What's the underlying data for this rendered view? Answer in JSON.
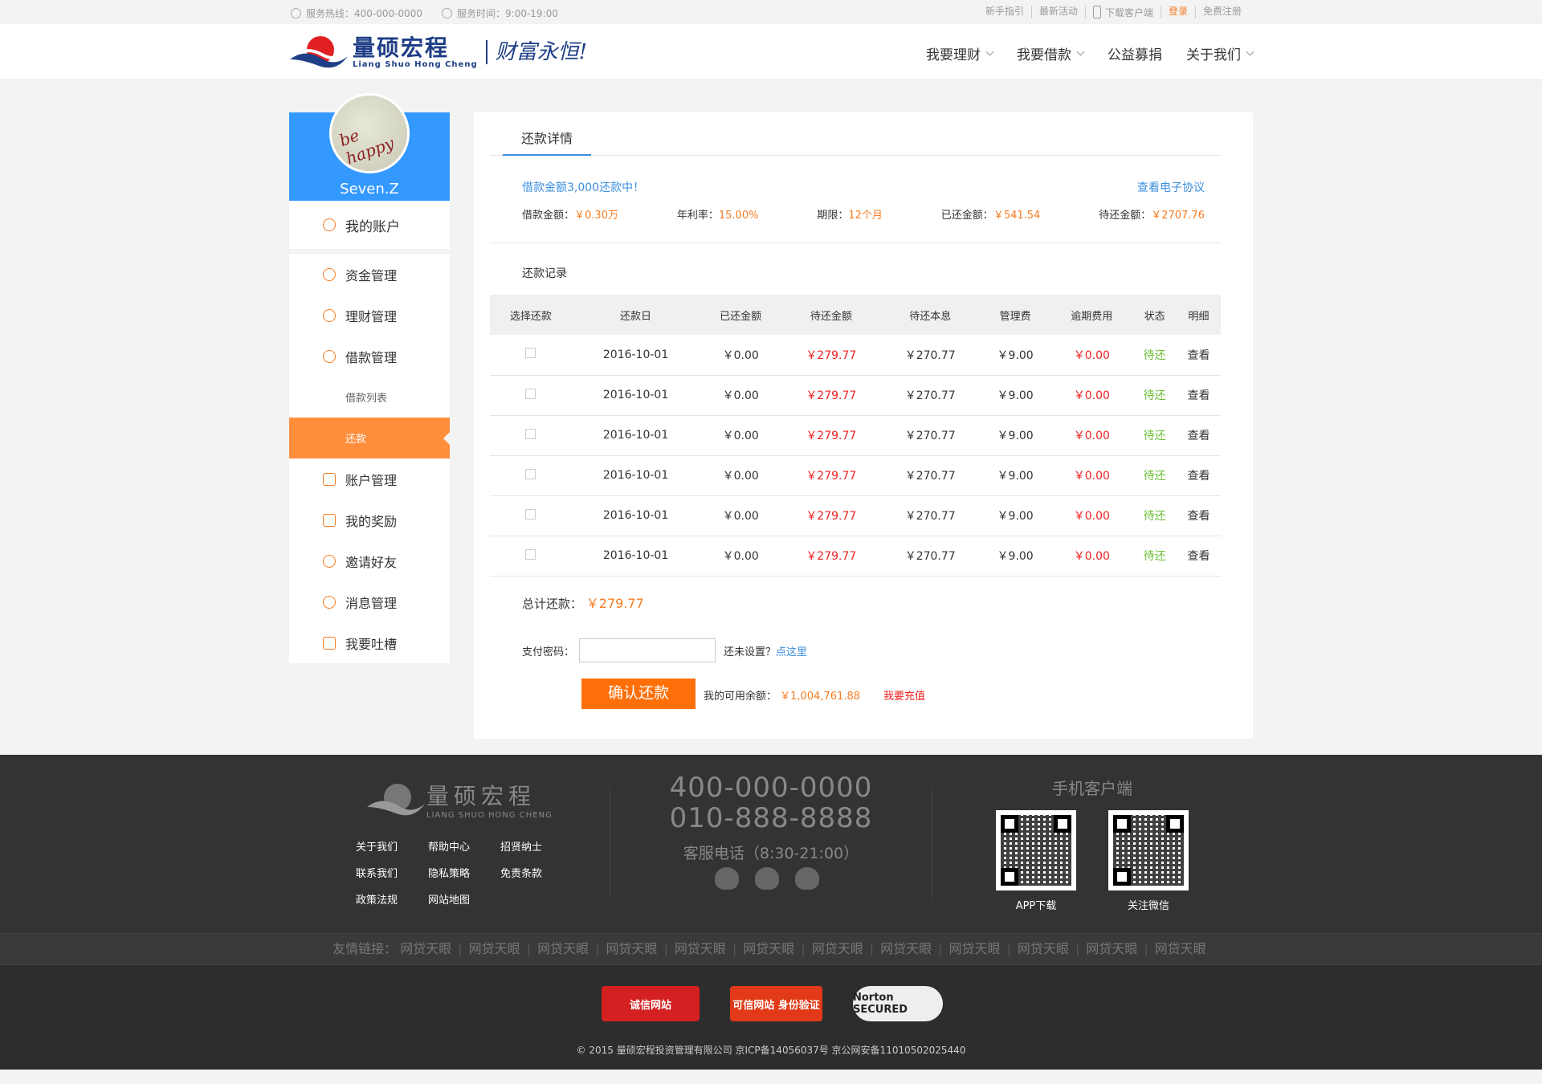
{
  "topbar": {
    "hotline": "服务热线：400-000-0000",
    "hours": "服务时间：9:00-19:00",
    "links": [
      "新手指引",
      "最新活动",
      "下载客户端",
      "登录",
      "免费注册"
    ]
  },
  "brand": {
    "cn": "量硕宏程",
    "en": "Liang Shuo Hong Cheng",
    "slogan": "财富永恒!"
  },
  "nav": [
    "我要理财",
    "我要借款",
    "公益募捐",
    "关于我们"
  ],
  "user": {
    "name": "Seven.Z",
    "avatar_text": "be happy"
  },
  "sidebar": {
    "account": "我的账户",
    "items": [
      "资金管理",
      "理财管理",
      "借款管理"
    ],
    "subs": [
      "借款列表",
      "还款"
    ],
    "items2": [
      "账户管理",
      "我的奖励",
      "邀请好友",
      "消息管理",
      "我要吐槽"
    ]
  },
  "tab": "还款详情",
  "loan": {
    "status": "借款金额3,000还款中！",
    "contract": "查看电子协议",
    "amount_label": "借款金额：",
    "amount": "￥0.30万",
    "rate_label": "年利率：",
    "rate": "15.00%",
    "term_label": "期限：",
    "term": "12个月",
    "repaid_label": "已还金额：",
    "repaid": "￥541.54",
    "due_label": "待还金额：",
    "due": "￥2707.76"
  },
  "records_title": "还款记录",
  "table": {
    "headers": [
      "选择还款",
      "还款日",
      "已还金额",
      "待还金额",
      "待还本息",
      "管理费",
      "逾期费用",
      "状态",
      "明细"
    ],
    "rows": [
      [
        "2016-10-01",
        "￥0.00",
        "￥279.77",
        "￥270.77",
        "￥9.00",
        "￥0.00",
        "待还",
        "查看"
      ],
      [
        "2016-10-01",
        "￥0.00",
        "￥279.77",
        "￥270.77",
        "￥9.00",
        "￥0.00",
        "待还",
        "查看"
      ],
      [
        "2016-10-01",
        "￥0.00",
        "￥279.77",
        "￥270.77",
        "￥9.00",
        "￥0.00",
        "待还",
        "查看"
      ],
      [
        "2016-10-01",
        "￥0.00",
        "￥279.77",
        "￥270.77",
        "￥9.00",
        "￥0.00",
        "待还",
        "查看"
      ],
      [
        "2016-10-01",
        "￥0.00",
        "￥279.77",
        "￥270.77",
        "￥9.00",
        "￥0.00",
        "待还",
        "查看"
      ],
      [
        "2016-10-01",
        "￥0.00",
        "￥279.77",
        "￥270.77",
        "￥9.00",
        "￥0.00",
        "待还",
        "查看"
      ]
    ]
  },
  "total": {
    "label": "总计还款：",
    "value": "￥279.77"
  },
  "payment": {
    "pwd_label": "支付密码：",
    "not_set": "还未设置？",
    "click_here": "点这里",
    "confirm": "确认还款",
    "balance_label": "我的可用余额：",
    "balance": "￥1,004,761.88",
    "recharge": "我要充值"
  },
  "footer": {
    "logo_cn": "量硕宏程",
    "logo_en": "LIANG SHUO HONG CHENG",
    "links": [
      "关于我们",
      "帮助中心",
      "招贤纳士",
      "联系我们",
      "隐私策略",
      "免责条款",
      "政策法规",
      "网站地图"
    ],
    "phone1": "400-000-0000",
    "phone2": "010-888-8888",
    "service": "客服电话（8:30-21:00）",
    "mobile": "手机客户端",
    "app": "APP下载",
    "wechat": "关注微信",
    "friend_label": "友情链接：",
    "friend": "网贷天眼",
    "badges": [
      "诚信网站",
      "可信网站 身份验证",
      "Norton SECURED"
    ],
    "copyright": "© 2015 量硕宏程投资管理有限公司 京ICP备14056037号 京公网安备11010502025440"
  }
}
